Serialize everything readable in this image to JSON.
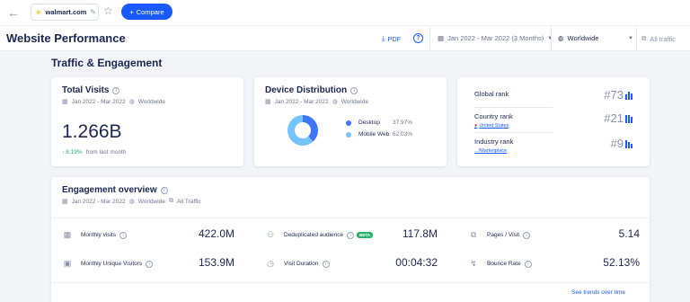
{
  "topbar": {
    "domain": "walmart.com",
    "compare_label": "Compare"
  },
  "header": {
    "title": "Website Performance",
    "pdf_label": "PDF",
    "help_label": "?",
    "date_range": "Jan 2022 - Mar 2022 (3 Months)",
    "geo": "Worldwide",
    "traffic": "All traffic"
  },
  "section_title": "Traffic & Engagement",
  "total_visits": {
    "title": "Total Visits",
    "date": "Jan 2022 - Mar 2022",
    "geo": "Worldwide",
    "value": "1.266B",
    "change": "8.19%",
    "change_label": "from last month"
  },
  "device_distribution": {
    "title": "Device Distribution",
    "date": "Jan 2022 - Mar 2022",
    "geo": "Worldwide",
    "desktop_label": "Desktop",
    "desktop_pct": "37.97%",
    "mobile_label": "Mobile Web",
    "mobile_pct": "62.03%",
    "desktop_share": 37.97,
    "colors": {
      "desktop": "#3e74fe",
      "mobile": "#74c5ff"
    }
  },
  "ranks": {
    "global_label": "Global rank",
    "global_value": "#73",
    "country_label": "Country rank",
    "country_sub": "United States",
    "country_value": "#21",
    "industry_label": "Industry rank",
    "industry_sub": ".../Marketplace",
    "industry_value": "#9"
  },
  "engagement": {
    "title": "Engagement overview",
    "date": "Jan 2022 - Mar 2022",
    "geo": "Worldwide",
    "traffic": "All Traffic",
    "monthly_visits_label": "Monthly visits",
    "monthly_visits_value": "422.0M",
    "dedup_label": "Deduplicated audience",
    "dedup_badge": "BETA",
    "dedup_value": "117.8M",
    "pages_label": "Pages / Visit",
    "pages_value": "5.14",
    "unique_label": "Monthly Unique Visitors",
    "unique_value": "153.9M",
    "duration_label": "Visit Duration",
    "duration_value": "00:04:32",
    "bounce_label": "Bounce Rate",
    "bounce_value": "52.13%",
    "trends_link": "See trends over time"
  },
  "colors": {
    "accent": "#195afe",
    "positive": "#26b36b",
    "text": "#1b2653"
  }
}
